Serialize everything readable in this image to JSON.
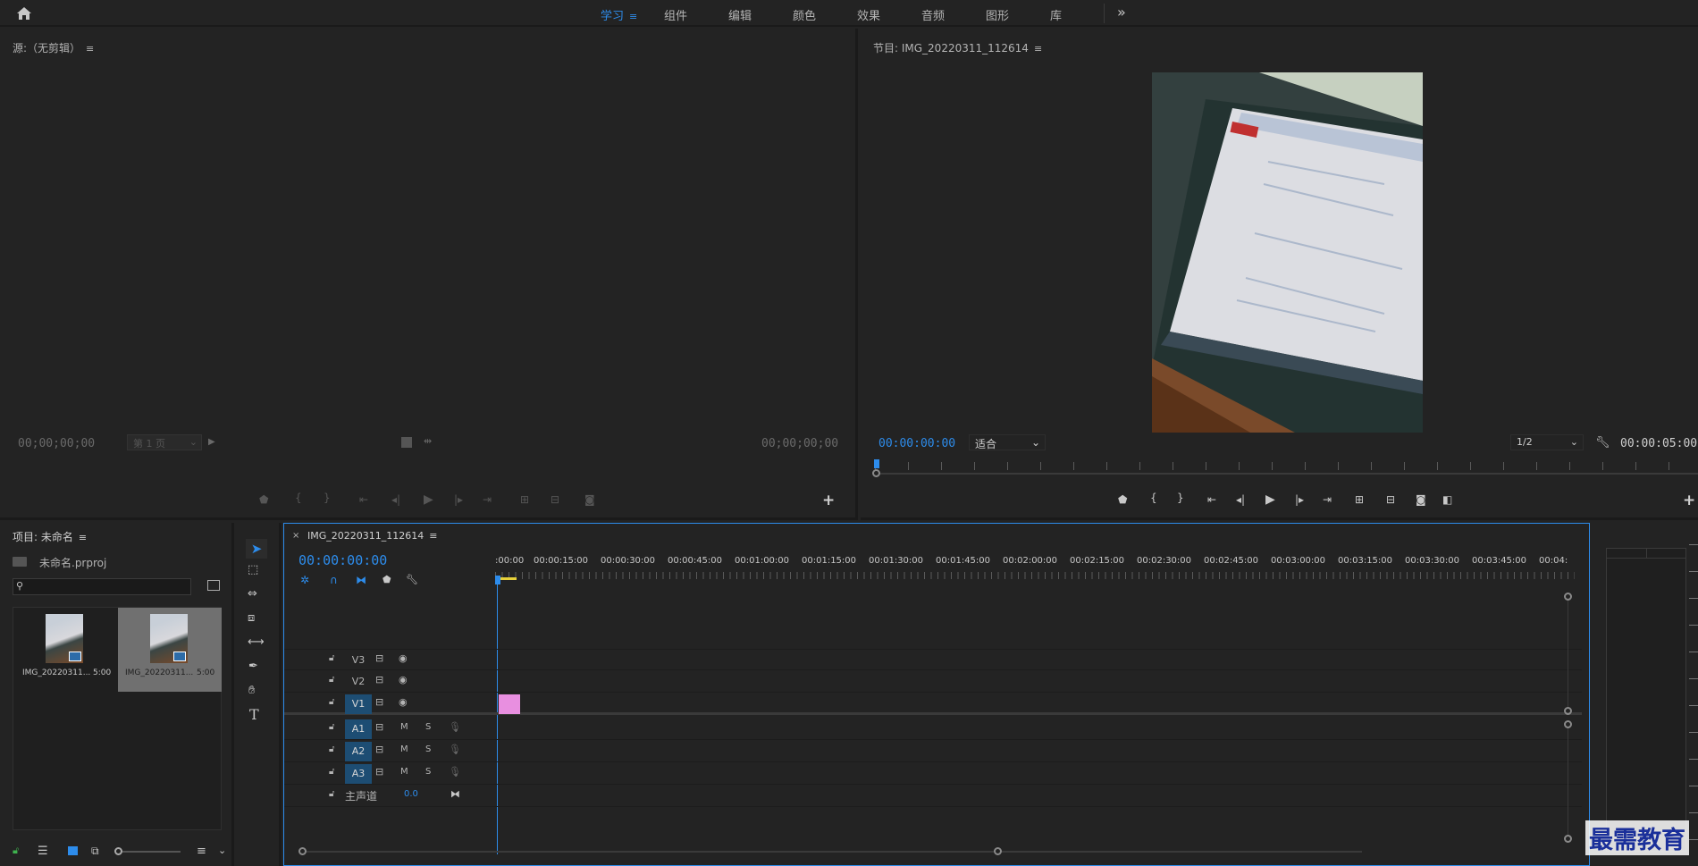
{
  "topbar": {
    "tabs": [
      {
        "label": "学习",
        "active": true
      },
      {
        "label": "组件"
      },
      {
        "label": "编辑"
      },
      {
        "label": "颜色"
      },
      {
        "label": "效果"
      },
      {
        "label": "音频"
      },
      {
        "label": "图形"
      },
      {
        "label": "库"
      }
    ],
    "more_label": "»"
  },
  "source": {
    "title": "源:（无剪辑）",
    "timecode_left": "00;00;00;00",
    "page_select": "第 1 页",
    "timecode_right": "00;00;00;00"
  },
  "program": {
    "title": "节目: IMG_20220311_112614",
    "timecode": "00:00:00:00",
    "fit_select": "适合",
    "resolution_select": "1/2",
    "duration": "00:00:05:00"
  },
  "project": {
    "title": "项目: 未命名",
    "file": "未命名.prproj",
    "search_placeholder": "",
    "items": [
      {
        "name": "IMG_20220311...",
        "duration": "5:00",
        "selected": false
      },
      {
        "name": "IMG_20220311...",
        "duration": "5:00",
        "selected": true
      }
    ]
  },
  "timeline": {
    "tab_title": "IMG_20220311_112614",
    "timecode": "00:00:00:00",
    "ruler": [
      ":00:00",
      "00:00:15:00",
      "00:00:30:00",
      "00:00:45:00",
      "00:01:00:00",
      "00:01:15:00",
      "00:01:30:00",
      "00:01:45:00",
      "00:02:00:00",
      "00:02:15:00",
      "00:02:30:00",
      "00:02:45:00",
      "00:03:00:00",
      "00:03:15:00",
      "00:03:30:00",
      "00:03:45:00",
      "00:04:"
    ],
    "video_tracks": [
      "V3",
      "V2",
      "V1"
    ],
    "audio_tracks": [
      "A1",
      "A2",
      "A3"
    ],
    "mute_label": "M",
    "solo_label": "S",
    "master_label": "主声道",
    "master_value": "0.0",
    "clip_color": "#e88fe0"
  },
  "watermark": "最需教育",
  "colors": {
    "accent": "#2d8ceb",
    "panel": "#232323",
    "background": "#1a1a1a"
  }
}
